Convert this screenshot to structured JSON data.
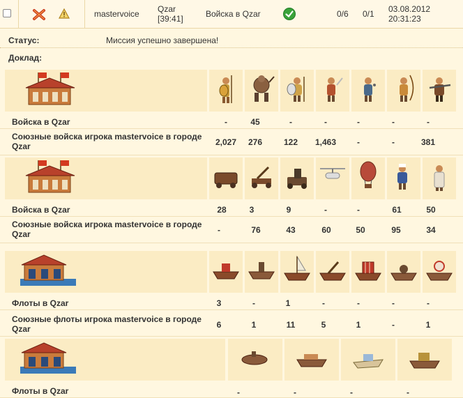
{
  "message": {
    "sender": "mastervoice",
    "city": "Qzar",
    "time": "[39:41]",
    "action": "Войска в Qzar",
    "count1": "0/6",
    "count2": "0/1",
    "date": "03.08.2012",
    "clock": "20:31:23"
  },
  "status": {
    "label": "Статус:",
    "value": "Миссия успешно завершена!"
  },
  "report": {
    "label": "Доклад:"
  },
  "sections": [
    {
      "rows": [
        {
          "label": "Войска в Qzar",
          "values": [
            "-",
            "45",
            "-",
            "-",
            "-",
            "-",
            "-"
          ]
        },
        {
          "label": "Союзные войска игрока mastervoice в городе Qzar",
          "values": [
            "2,027",
            "276",
            "122",
            "1,463",
            "-",
            "-",
            "381"
          ]
        }
      ]
    },
    {
      "rows": [
        {
          "label": "Войска в Qzar",
          "values": [
            "28",
            "3",
            "9",
            "-",
            "-",
            "61",
            "50"
          ]
        },
        {
          "label": "Союзные войска игрока mastervoice в городе Qzar",
          "values": [
            "-",
            "76",
            "43",
            "60",
            "50",
            "95",
            "34"
          ]
        }
      ]
    },
    {
      "rows": [
        {
          "label": "Флоты в Qzar",
          "values": [
            "3",
            "-",
            "1",
            "-",
            "-",
            "-",
            "-"
          ]
        },
        {
          "label": "Союзные флоты игрока mastervoice в городе Qzar",
          "values": [
            "6",
            "1",
            "11",
            "5",
            "1",
            "-",
            "1"
          ]
        }
      ]
    },
    {
      "rows": [
        {
          "label": "Флоты в Qzar",
          "values": [
            "-",
            "-",
            "-",
            "-"
          ]
        }
      ]
    }
  ],
  "icons": {
    "delete": "delete-x-icon",
    "warning": "warning-triangle-icon",
    "success": "success-check-icon"
  },
  "colors": {
    "panel": "#fbecc4",
    "accent_green": "#39a33a",
    "warning": "#d4a22a"
  }
}
